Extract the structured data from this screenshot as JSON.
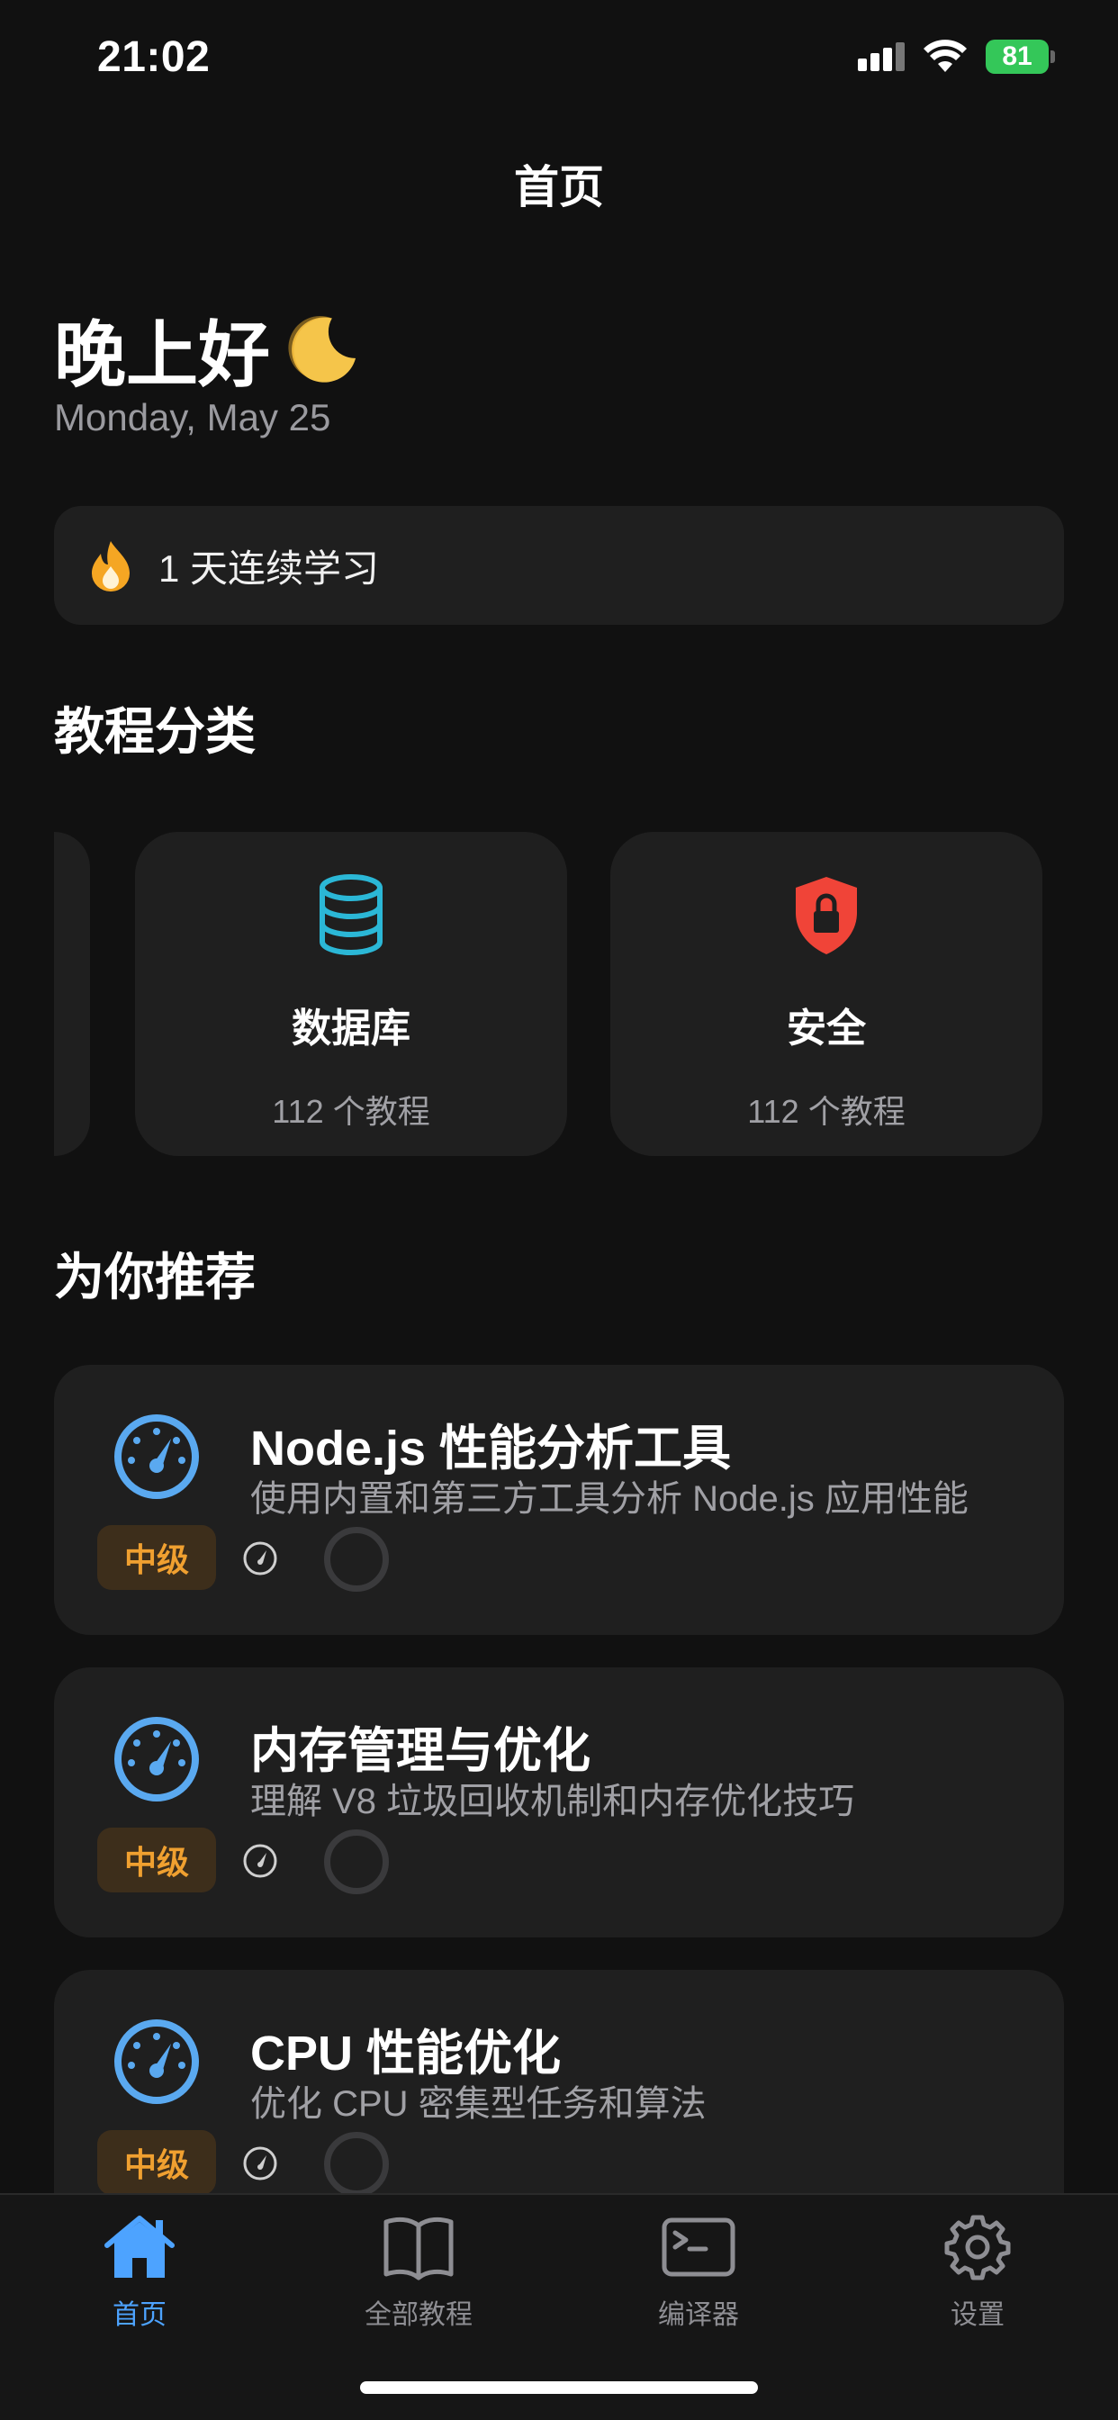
{
  "status_bar": {
    "time": "21:02",
    "battery": "81"
  },
  "nav": {
    "title": "首页"
  },
  "greeting": {
    "text": "晚上好",
    "date": "Monday, May 25"
  },
  "streak": {
    "text": "1 天连续学习"
  },
  "categories": {
    "title": "教程分类",
    "items": [
      {
        "name": "数据库",
        "count": "112 个教程",
        "icon": "database-icon",
        "color": "#2bb7d6"
      },
      {
        "name": "安全",
        "count": "112 个教程",
        "icon": "shield-lock-icon",
        "color": "#f04438"
      }
    ]
  },
  "recommend": {
    "title": "为你推荐",
    "items": [
      {
        "title": "Node.js 性能分析工具",
        "desc": "使用内置和第三方工具分析 Node.js 应用性能",
        "level": "中级",
        "icon": "speedometer-icon"
      },
      {
        "title": "内存管理与优化",
        "desc": "理解 V8 垃圾回收机制和内存优化技巧",
        "level": "中级",
        "icon": "speedometer-icon"
      },
      {
        "title": "CPU 性能优化",
        "desc": "优化 CPU 密集型任务和算法",
        "level": "中级",
        "icon": "speedometer-icon"
      }
    ]
  },
  "tabs": [
    {
      "label": "首页",
      "icon": "home-icon",
      "active": true
    },
    {
      "label": "全部教程",
      "icon": "book-icon",
      "active": false
    },
    {
      "label": "编译器",
      "icon": "terminal-icon",
      "active": false
    },
    {
      "label": "设置",
      "icon": "gear-icon",
      "active": false
    }
  ],
  "colors": {
    "accent": "#4da3ff",
    "background": "#111111",
    "card": "#1f1f1f",
    "badge_text": "#f0a030",
    "badge_bg": "#3d2e1b"
  }
}
